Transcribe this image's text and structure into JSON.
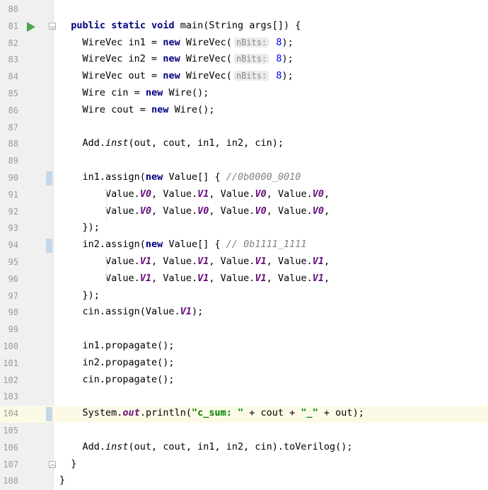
{
  "editor": {
    "lines": [
      {
        "n": "80"
      },
      {
        "n": "81"
      },
      {
        "n": "82"
      },
      {
        "n": "83"
      },
      {
        "n": "84"
      },
      {
        "n": "85"
      },
      {
        "n": "86"
      },
      {
        "n": "87"
      },
      {
        "n": "88"
      },
      {
        "n": "89"
      },
      {
        "n": "90"
      },
      {
        "n": "91"
      },
      {
        "n": "92"
      },
      {
        "n": "93"
      },
      {
        "n": "94"
      },
      {
        "n": "95"
      },
      {
        "n": "96"
      },
      {
        "n": "97"
      },
      {
        "n": "98"
      },
      {
        "n": "99"
      },
      {
        "n": "100"
      },
      {
        "n": "101"
      },
      {
        "n": "102"
      },
      {
        "n": "103"
      },
      {
        "n": "104"
      },
      {
        "n": "105"
      },
      {
        "n": "106"
      },
      {
        "n": "107"
      },
      {
        "n": "108"
      }
    ],
    "t": {
      "public": "public",
      "static": "static",
      "void": "void",
      "main_sig": " main(String args[]) {",
      "wv": "WireVec",
      "in1_decl": " in1 = ",
      "in2_decl": " in2 = ",
      "out_decl": " out = ",
      "new": "new",
      "wv_call": " WireVec(",
      "hint_label": "nBits:",
      "eight": "8",
      "close_semi": ");",
      "wire": "Wire",
      "cin_decl": " cin = ",
      "cout_decl": " cout = ",
      "wire_call": " Wire();",
      "add": "Add.",
      "inst": "inst",
      "args": "(out, cout, in1, in2, cin);",
      "in1_assign": "in1.assign(",
      "in2_assign": "in2.assign(",
      "value_arr": " Value[] { ",
      "cmt1": "//0b0000_0010",
      "cmt2": "// 0b1111_1111",
      "value": "Value.",
      "v0": "V0",
      "v1": "V1",
      "sep": ", ",
      "comma": ",",
      "close_arr": "});",
      "cin_assign": "cin.assign(Value.",
      "close_paren": ");",
      "in1_prop": "in1.propagate();",
      "in2_prop": "in2.propagate();",
      "cin_prop": "cin.propagate();",
      "system": "System.",
      "out_field": "out",
      "println": ".println(",
      "str1": "\"c_sum: \"",
      "plus_cout": " + cout + ",
      "str2": "\"_\"",
      "plus_out": " + out);",
      "args2": "(out, cout, in1, in2, cin).toVerilog();",
      "brace": "}"
    }
  }
}
